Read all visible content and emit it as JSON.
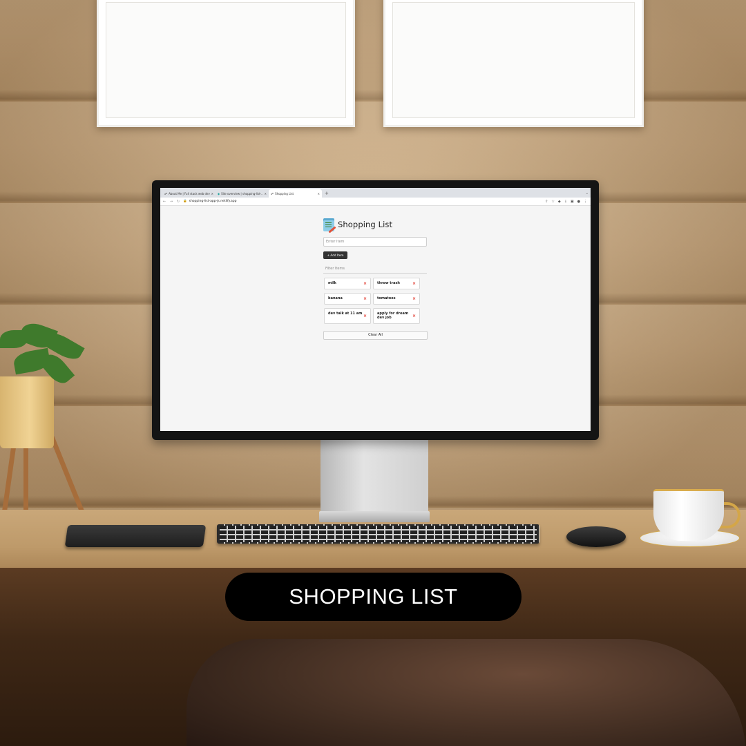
{
  "browser": {
    "tabs": [
      {
        "label": "About Me | Full stack web dev...",
        "icon": "globe-icon",
        "active": false
      },
      {
        "label": "Site overview | shopping-list-...",
        "icon": "netlify-icon",
        "active": false
      },
      {
        "label": "Shopping List",
        "icon": "globe-icon",
        "active": true
      }
    ],
    "new_tab_symbol": "+",
    "url": "shopping-list-app-js.netlify.app"
  },
  "app": {
    "title": "Shopping List",
    "item_input_placeholder": "Enter Item",
    "add_button_label": "+ Add Item",
    "filter_placeholder": "Filter Items",
    "items": [
      {
        "label": "milk"
      },
      {
        "label": "throw trash"
      },
      {
        "label": "banana"
      },
      {
        "label": "tomatoes"
      },
      {
        "label": "dev talk at 11 am"
      },
      {
        "label": "apply for dream dev job"
      }
    ],
    "remove_symbol": "×",
    "clear_button_label": "Clear All"
  },
  "caption": {
    "text": "SHOPPING LIST"
  },
  "colors": {
    "accent_remove": "#e03a2f",
    "button_dark": "#333333",
    "caption_bg": "#000000"
  }
}
